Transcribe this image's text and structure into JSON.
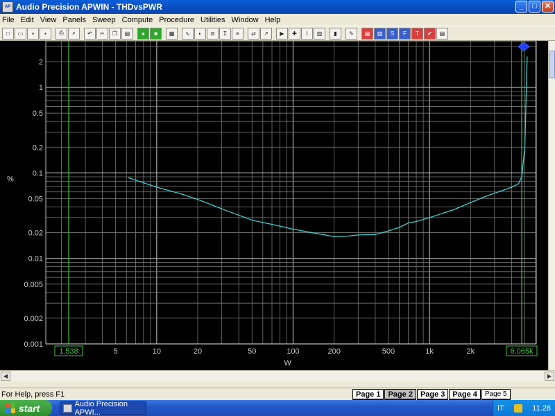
{
  "window": {
    "title": "Audio Precision APWIN - THDvsPWR",
    "icon": "ap-app-icon",
    "minimize": "_",
    "maximize": "□",
    "close": "✕"
  },
  "menu": [
    "File",
    "Edit",
    "View",
    "Panels",
    "Sweep",
    "Compute",
    "Procedure",
    "Utilities",
    "Window",
    "Help"
  ],
  "toolbar": {
    "icons": [
      "new-icon",
      "open-icon",
      "save-icon",
      "save-all-icon",
      "sep",
      "print-icon",
      "print-preview-icon",
      "sep",
      "undo-icon",
      "cut-icon",
      "copy-icon",
      "paste-icon",
      "sep",
      "go-icon",
      "stop-icon",
      "sep",
      "filter-icon",
      "sep",
      "generator-icon",
      "analyzer-icon",
      "switcher-icon",
      "dcx-icon",
      "stat-icon",
      "sep",
      "sweep-icon",
      "tracking-icon",
      "sep",
      "sweep-settings-icon",
      "regulation-icon",
      "graph-icon",
      "data-icon",
      "sep",
      "bargraph-icon",
      "sep",
      "edit-icon",
      "sep",
      "graph-page-icon",
      "spectrum-icon",
      "snr-icon",
      "fft-icon",
      "thd-icon",
      "check-icon",
      "report-icon"
    ]
  },
  "chart_data": {
    "type": "line",
    "xscale": "log",
    "yscale": "log",
    "xlabel": "W",
    "ylabel": "%",
    "xlim": [
      1.538,
      6065
    ],
    "ylim": [
      0.001,
      3.5
    ],
    "x_ticks": [
      "2",
      "5",
      "10",
      "20",
      "50",
      "100",
      "200",
      "500",
      "1k",
      "2k"
    ],
    "x_tick_values": [
      2,
      5,
      10,
      20,
      50,
      100,
      200,
      500,
      1000,
      2000
    ],
    "y_ticks": [
      "2",
      "1",
      "0.5",
      "0.2",
      "0.1",
      "0.05",
      "0.02",
      "0.01",
      "0.005",
      "0.002",
      "0.001"
    ],
    "y_tick_values": [
      2,
      1,
      0.5,
      0.2,
      0.1,
      0.05,
      0.02,
      0.01,
      0.005,
      0.002,
      0.001
    ],
    "grid": true,
    "cursor_left": "1.538",
    "cursor_right": "6.065k",
    "series": [
      {
        "color": "#40d0d0",
        "x": [
          6.2,
          10,
          15,
          20,
          30,
          50,
          70,
          100,
          150,
          200,
          250,
          300,
          400,
          500,
          600,
          700,
          800,
          1000,
          1500,
          2000,
          2500,
          3000,
          3500,
          4000,
          4500,
          4750,
          5000,
          5200
        ],
        "y": [
          0.088,
          0.068,
          0.057,
          0.049,
          0.038,
          0.028,
          0.025,
          0.022,
          0.0195,
          0.018,
          0.0182,
          0.0188,
          0.019,
          0.021,
          0.023,
          0.026,
          0.027,
          0.03,
          0.037,
          0.045,
          0.052,
          0.058,
          0.063,
          0.068,
          0.075,
          0.09,
          0.2,
          2.3
        ]
      }
    ],
    "marker_x": 6065,
    "marker_y": 3.0
  },
  "status": {
    "message": "For Help, press F1",
    "pages": [
      "Page 1",
      "Page 2",
      "Page 3",
      "Page 4",
      "Page 5"
    ],
    "active_page": 1
  },
  "taskbar": {
    "start": "start",
    "task": "Audio Precision APWI...",
    "lang": "IT",
    "clock": "11.28"
  }
}
